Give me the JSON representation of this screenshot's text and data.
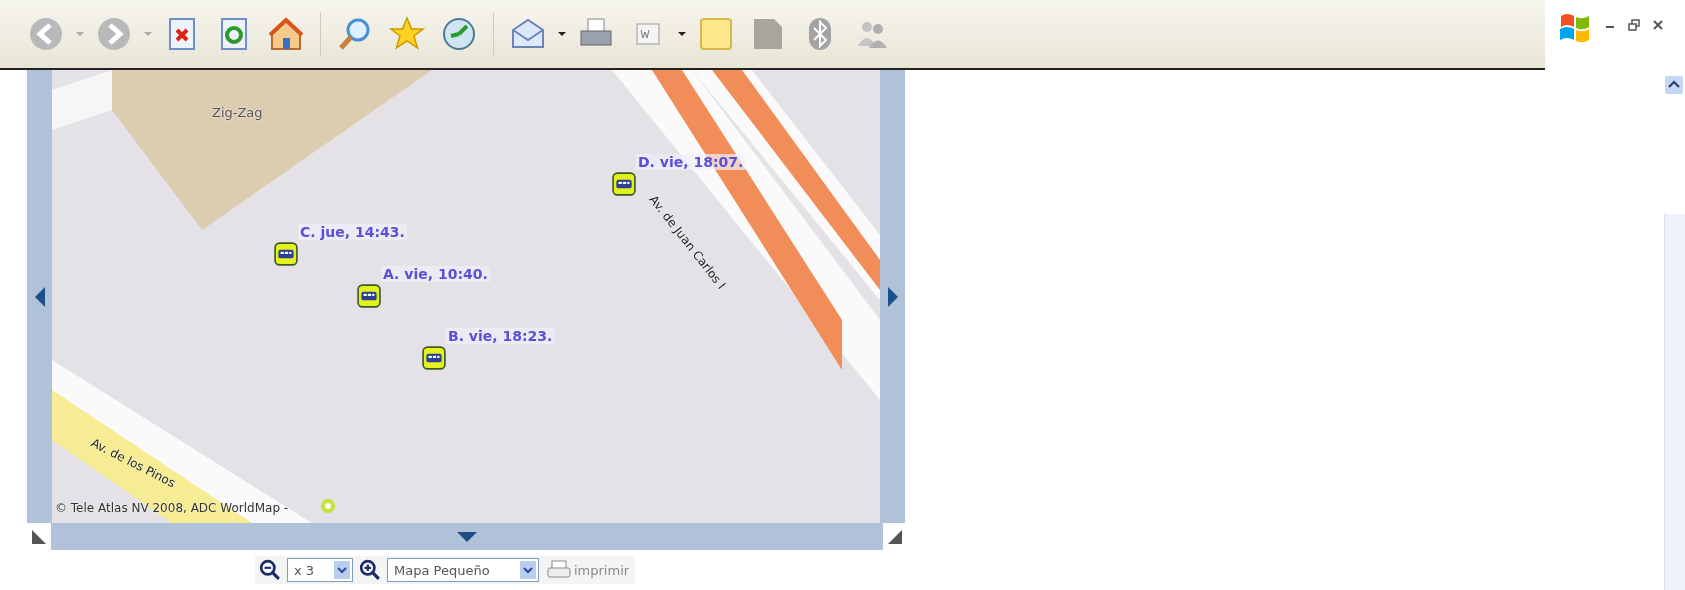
{
  "map": {
    "place_label": "Zig-Zag",
    "streets": [
      {
        "kind": "main",
        "name": "Av. de Juan Carlos I"
      },
      {
        "kind": "side",
        "name": "Av. de los Pinos"
      }
    ],
    "markers": [
      {
        "label": "D. vie, 18:07."
      },
      {
        "label": "C. jue, 14:43."
      },
      {
        "label": "A. vie, 10:40."
      },
      {
        "label": "B. vie, 18:23."
      }
    ],
    "copyright": "© Tele Atlas NV 2008, ADC WorldMap -"
  },
  "controls": {
    "zoom": "x 3",
    "map_size": "Mapa Pequeño",
    "print": "imprimir"
  }
}
